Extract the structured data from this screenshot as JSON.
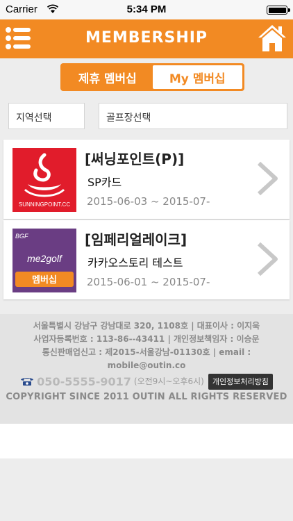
{
  "status_bar": {
    "carrier": "Carrier",
    "time": "5:34 PM"
  },
  "header": {
    "title": "MEMBERSHIP",
    "menu_icon": "list-menu-icon",
    "home_icon": "home-icon"
  },
  "tabs": [
    {
      "label": "제휴 멤버십",
      "active": true
    },
    {
      "label": "My 멤버십",
      "active": false
    }
  ],
  "filters": {
    "region": "지역선택",
    "golf_course": "골프장선택"
  },
  "memberships": [
    {
      "name": "[써닝포인트(P)]",
      "subtitle": "SP카드",
      "date_range": "2015-06-03 ~ 2015-07-",
      "logo": {
        "text": "SUNNINGPOINT.CC",
        "bg": "#e11c2b"
      }
    },
    {
      "name": "[임페리얼레이크]",
      "subtitle": "카카오스토리 테스트",
      "date_range": "2015-06-01 ~ 2015-07-",
      "logo": {
        "top_text": "BGF",
        "text": "me2golf",
        "badge": "멤버십",
        "bg": "#6a3d83"
      }
    }
  ],
  "footer": {
    "line1": "서울특별시 강남구 강남대로 320, 1108호 | 대표이사 : 이지욱",
    "line2": "사업자등록번호 : 113-86--43411 | 개인정보책임자 : 이승운",
    "line3": "통신판매업신고 : 제2015-서울강남-01130호 | email :",
    "line4": "mobile@outin.co",
    "phone": "050-5555-9017",
    "hours": "(오전9시~오후6시)",
    "privacy": "개인정보처리방침",
    "copyright": "COPYRIGHT SINCE 2011 OUTIN ALL RIGHTS RESERVED"
  },
  "colors": {
    "accent": "#f28a23",
    "card_bg": "#ffffff",
    "page_bg": "#ededed"
  }
}
